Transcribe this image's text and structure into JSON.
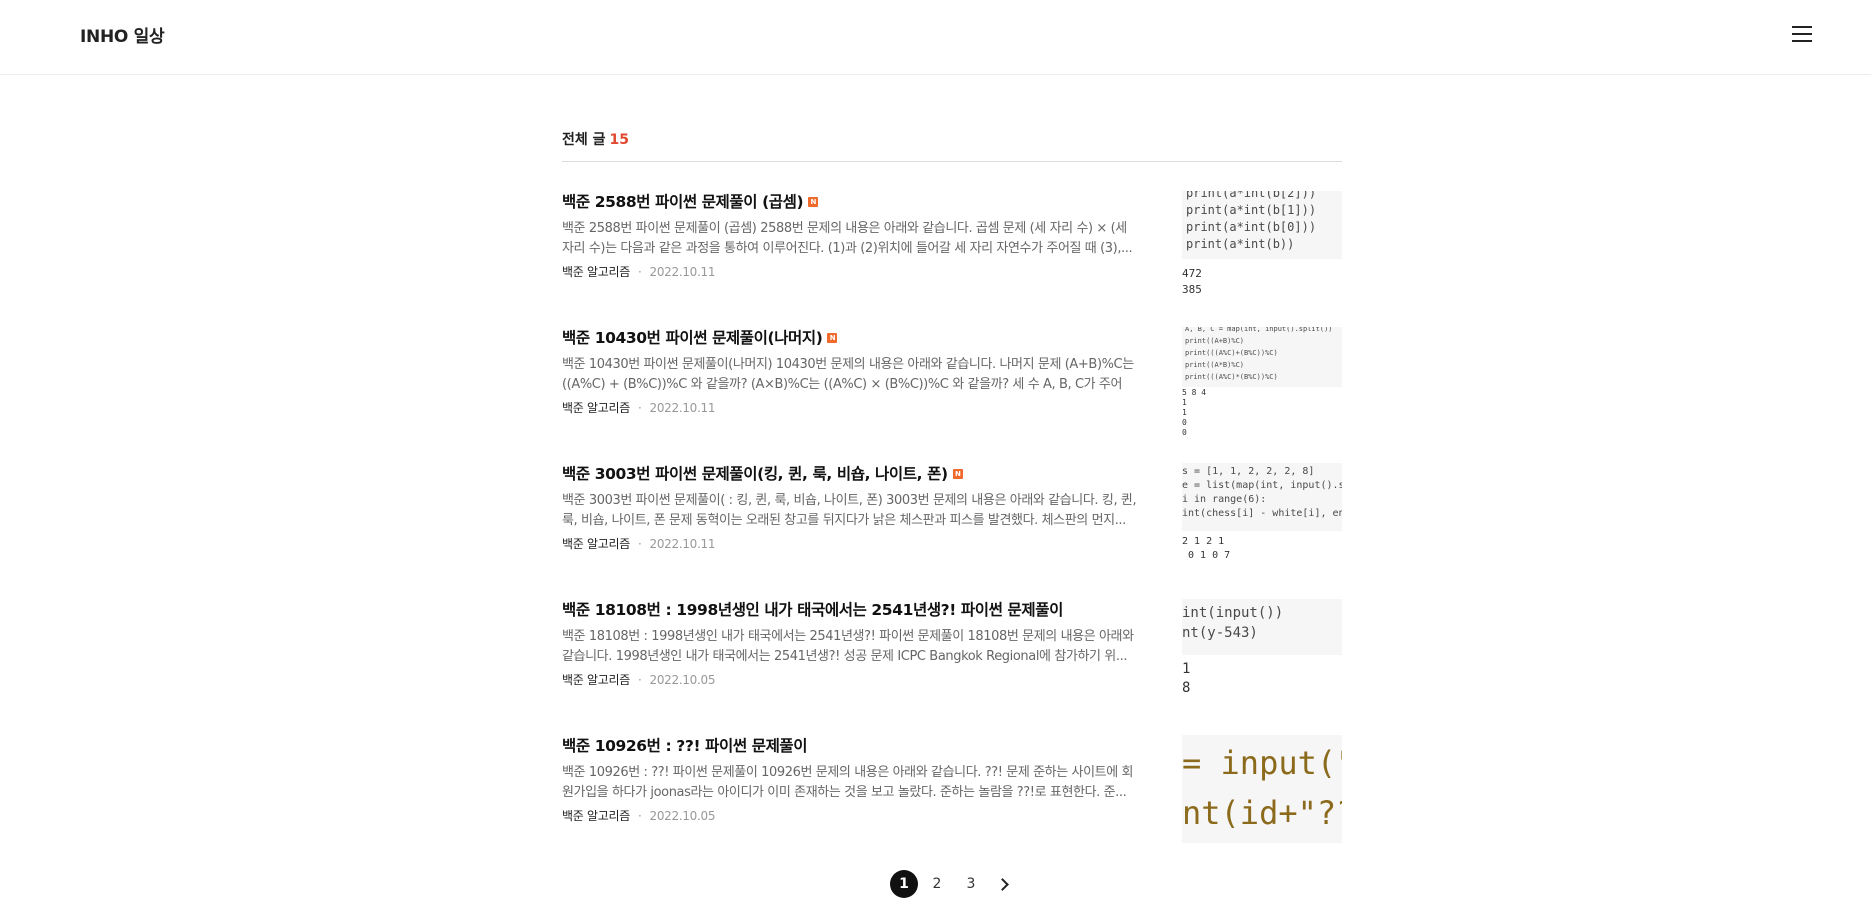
{
  "header": {
    "blog_title": "INHO 일상",
    "menu_icon": "hamburger-menu-icon"
  },
  "list": {
    "heading_label": "전체 글",
    "count": "15"
  },
  "posts": [
    {
      "title": "백준 2588번 파이썬 문제풀이 (곱셈)",
      "new_badge": "N",
      "excerpt": "백준 2588번 파이썬 문제풀이 (곱셈) 2588번 문제의 내용은 아래와 같습니다. 곱셈 문제 (세 자리 수) × (세 자리 수)는 다음과 같은 과정을 통하여 이루어진다. (1)과 (2)위치에 들어갈 세 자리 자연수가 주어질 때 (3),...",
      "category": "백준 알고리즘",
      "date": "2022.10.11",
      "thumb": {
        "code": [
          "print(a*int(b[2]))",
          "print(a*int(b[1]))",
          "print(a*int(b[0]))",
          "print(a*int(b))"
        ],
        "output": [
          "472",
          "385"
        ]
      }
    },
    {
      "title": "백준 10430번 파이썬 문제풀이(나머지)",
      "new_badge": "N",
      "excerpt": "백준 10430번 파이썬 문제풀이(나머지) 10430번 문제의 내용은 아래와 같습니다. 나머지 문제 (A+B)%C는 ((A%C) + (B%C))%C 와 같을까? (A×B)%C는 ((A%C) × (B%C))%C 와 같을까? 세 수 A, B, C가 주어졌...",
      "category": "백준 알고리즘",
      "date": "2022.10.11",
      "thumb": {
        "code": [
          "A, B, C = map(int, input().split())",
          "print((A+B)%C)",
          "print(((A%C)+(B%C))%C)",
          "print((A*B)%C)",
          "print(((A%C)*(B%C))%C)"
        ],
        "output": [
          "5 8 4",
          "1",
          "1",
          "0",
          "0"
        ]
      }
    },
    {
      "title": "백준 3003번 파이썬 문제풀이(킹, 퀸, 룩, 비숍, 나이트, 폰)",
      "new_badge": "N",
      "excerpt": "백준 3003번 파이썬 문제풀이( : 킹, 퀸, 룩, 비숍, 나이트, 폰) 3003번 문제의 내용은 아래와 같습니다. 킹, 퀸, 룩, 비숍, 나이트, 폰 문제 동혁이는 오래된 창고를 뒤지다가 낡은 체스판과 피스를 발견했다. 체스판의 먼지...",
      "category": "백준 알고리즘",
      "date": "2022.10.11",
      "thumb": {
        "code": [
          "s = [1, 1, 2, 2, 2, 8]",
          "e = list(map(int, input().split",
          "i in range(6):",
          "int(chess[i] - white[i], end=\""
        ],
        "output": [
          "2 1 2 1",
          " 0 1 0 7"
        ]
      }
    },
    {
      "title": "백준 18108번 : 1998년생인 내가 태국에서는 2541년생?! 파이썬 문제풀이",
      "new_badge": "",
      "excerpt": "백준 18108번 : 1998년생인 내가 태국에서는 2541년생?! 파이썬 문제풀이 18108번 문제의 내용은 아래와 같습니다. 1998년생인 내가 태국에서는 2541년생?! 성공 문제 ICPC Bangkok Regional에 참가하기 위...",
      "category": "백준 알고리즘",
      "date": "2022.10.05",
      "thumb": {
        "code": [
          " int(input())",
          "nt(y-543)"
        ],
        "output": [
          "1",
          "8"
        ]
      }
    },
    {
      "title": "백준 10926번 : ??! 파이썬 문제풀이",
      "new_badge": "",
      "excerpt": "백준 10926번 : ??! 파이썬 문제풀이 10926번 문제의 내용은 아래와 같습니다. ??! 문제 준하는 사이트에 회원가입을 하다가 joonas라는 아이디가 이미 존재하는 것을 보고 놀랐다. 준하는 놀람을 ??!로 표현한다. 준...",
      "category": "백준 알고리즘",
      "date": "2022.10.05",
      "thumb": {
        "code": [
          "= input(\"",
          "nt(id+\"??"
        ],
        "output": []
      }
    }
  ],
  "pagination": {
    "pages": [
      "1",
      "2",
      "3"
    ],
    "current": "1",
    "next_icon": "chevron-right-icon"
  },
  "colors": {
    "count_accent": "#e0482f",
    "new_badge": "#f06a2c",
    "active_page": "#111111"
  }
}
